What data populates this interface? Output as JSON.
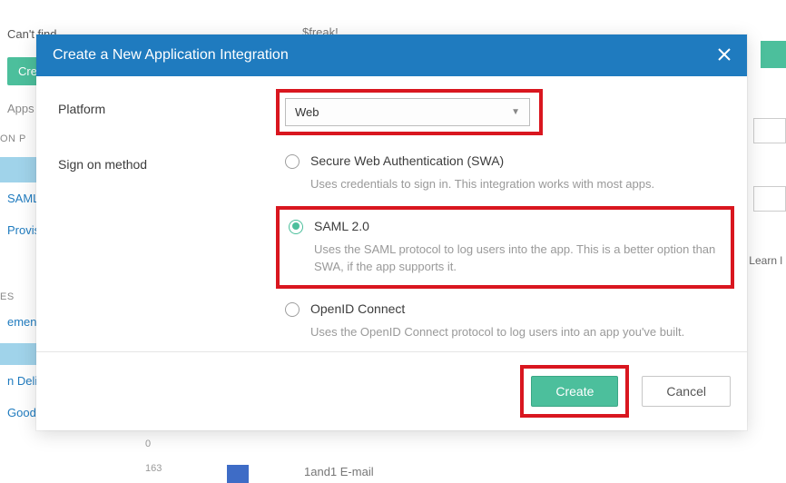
{
  "bg": {
    "cantFind": "Can't find",
    "cre": "Cre",
    "appsYo": "Apps yo",
    "sectionOnP": "ON P",
    "saml": "SAML",
    "provisio": "Provisio",
    "sectionEs": "ES",
    "ement": "ement",
    "nDeliv": "n Deliv",
    "good": "Good",
    "freaklabel": "$freak!",
    "learn": "Learn l",
    "num163": "163",
    "num0": "0",
    "item_bottom": "1and1 E-mail"
  },
  "modal": {
    "title": "Create a New Application Integration",
    "platform_label": "Platform",
    "platform_value": "Web",
    "signon_label": "Sign on method",
    "options": {
      "swa": {
        "title": "Secure Web Authentication (SWA)",
        "desc": "Uses credentials to sign in. This integration works with most apps."
      },
      "saml": {
        "title": "SAML 2.0",
        "desc": "Uses the SAML protocol to log users into the app. This is a better option than SWA, if the app supports it."
      },
      "openid": {
        "title": "OpenID Connect",
        "desc": "Uses the OpenID Connect protocol to log users into an app you've built."
      }
    },
    "buttons": {
      "create": "Create",
      "cancel": "Cancel"
    }
  }
}
